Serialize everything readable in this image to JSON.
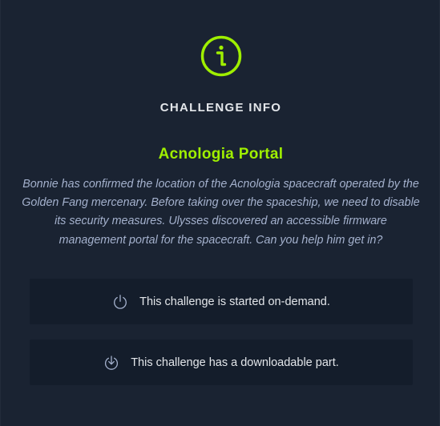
{
  "modal": {
    "heading": "CHALLENGE INFO",
    "challenge_name": "Acnologia Portal",
    "description": "Bonnie has confirmed the location of the Acnologia spacecraft operated by the Golden Fang mercenary. Before taking over the spaceship, we need to disable its security measures. Ulysses discovered an accessible firmware management portal for the spacecraft. Can you help him get in?",
    "features": [
      {
        "icon": "power-icon",
        "text": "This challenge is started on-demand."
      },
      {
        "icon": "download-icon",
        "text": "This challenge has a downloadable part."
      }
    ]
  },
  "colors": {
    "background": "#1a2332",
    "panel": "#141d2b",
    "accent": "#9fef00",
    "heading": "#e3e6ea",
    "body_text": "#a4b1cd",
    "icon": "#a4b1cd"
  }
}
